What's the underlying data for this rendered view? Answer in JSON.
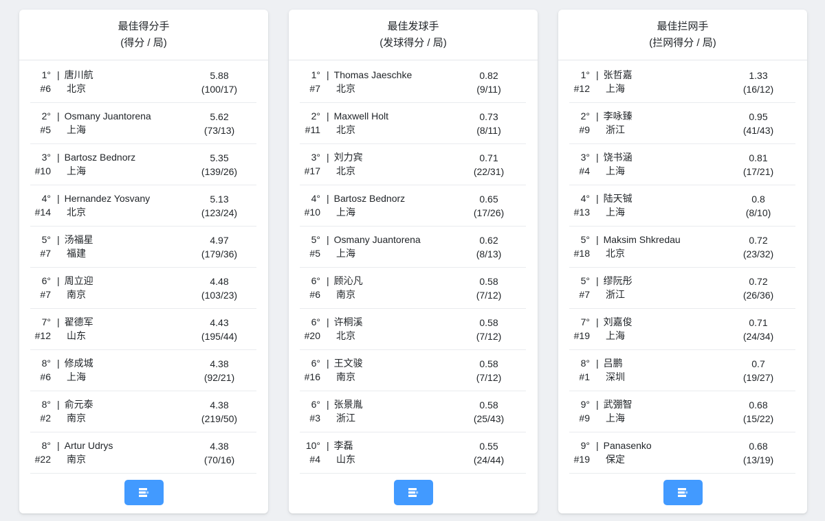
{
  "colors": {
    "accent_blue": "#429aff",
    "text": "#212529",
    "divider": "#e9ebee",
    "page_background": "#eef0f3",
    "card_background": "#ffffff"
  },
  "ui": {
    "pipe": "|",
    "footer_button_icon": "list-stats-icon"
  },
  "cards": [
    {
      "title": "最佳得分手",
      "subtitle": "(得分 / 局)",
      "rows": [
        {
          "rank": "1°",
          "number": "#6",
          "name": "唐川航",
          "team": "北京",
          "value": "5.88",
          "fraction": "(100/17)"
        },
        {
          "rank": "2°",
          "number": "#5",
          "name": "Osmany Juantorena",
          "team": "上海",
          "value": "5.62",
          "fraction": "(73/13)"
        },
        {
          "rank": "3°",
          "number": "#10",
          "name": "Bartosz Bednorz",
          "team": "上海",
          "value": "5.35",
          "fraction": "(139/26)"
        },
        {
          "rank": "4°",
          "number": "#14",
          "name": "Hernandez Yosvany",
          "team": "北京",
          "value": "5.13",
          "fraction": "(123/24)"
        },
        {
          "rank": "5°",
          "number": "#7",
          "name": "汤福星",
          "team": "福建",
          "value": "4.97",
          "fraction": "(179/36)"
        },
        {
          "rank": "6°",
          "number": "#7",
          "name": "周立迎",
          "team": "南京",
          "value": "4.48",
          "fraction": "(103/23)"
        },
        {
          "rank": "7°",
          "number": "#12",
          "name": "翟德军",
          "team": "山东",
          "value": "4.43",
          "fraction": "(195/44)"
        },
        {
          "rank": "8°",
          "number": "#6",
          "name": "修成城",
          "team": "上海",
          "value": "4.38",
          "fraction": "(92/21)"
        },
        {
          "rank": "8°",
          "number": "#2",
          "name": "俞元泰",
          "team": "南京",
          "value": "4.38",
          "fraction": "(219/50)"
        },
        {
          "rank": "8°",
          "number": "#22",
          "name": "Artur Udrys",
          "team": "南京",
          "value": "4.38",
          "fraction": "(70/16)"
        }
      ]
    },
    {
      "title": "最佳发球手",
      "subtitle": "(发球得分 / 局)",
      "rows": [
        {
          "rank": "1°",
          "number": "#7",
          "name": "Thomas Jaeschke",
          "team": "北京",
          "value": "0.82",
          "fraction": "(9/11)"
        },
        {
          "rank": "2°",
          "number": "#11",
          "name": "Maxwell Holt",
          "team": "北京",
          "value": "0.73",
          "fraction": "(8/11)"
        },
        {
          "rank": "3°",
          "number": "#17",
          "name": "刘力宾",
          "team": "北京",
          "value": "0.71",
          "fraction": "(22/31)"
        },
        {
          "rank": "4°",
          "number": "#10",
          "name": "Bartosz Bednorz",
          "team": "上海",
          "value": "0.65",
          "fraction": "(17/26)"
        },
        {
          "rank": "5°",
          "number": "#5",
          "name": "Osmany Juantorena",
          "team": "上海",
          "value": "0.62",
          "fraction": "(8/13)"
        },
        {
          "rank": "6°",
          "number": "#6",
          "name": "顾沁凡",
          "team": "南京",
          "value": "0.58",
          "fraction": "(7/12)"
        },
        {
          "rank": "6°",
          "number": "#20",
          "name": "许桐溪",
          "team": "北京",
          "value": "0.58",
          "fraction": "(7/12)"
        },
        {
          "rank": "6°",
          "number": "#16",
          "name": "王文骏",
          "team": "南京",
          "value": "0.58",
          "fraction": "(7/12)"
        },
        {
          "rank": "6°",
          "number": "#3",
          "name": "张景胤",
          "team": "浙江",
          "value": "0.58",
          "fraction": "(25/43)"
        },
        {
          "rank": "10°",
          "number": "#4",
          "name": "李磊",
          "team": "山东",
          "value": "0.55",
          "fraction": "(24/44)"
        }
      ]
    },
    {
      "title": "最佳拦网手",
      "subtitle": "(拦网得分 / 局)",
      "rows": [
        {
          "rank": "1°",
          "number": "#12",
          "name": "张哲嘉",
          "team": "上海",
          "value": "1.33",
          "fraction": "(16/12)"
        },
        {
          "rank": "2°",
          "number": "#9",
          "name": "李咏臻",
          "team": "浙江",
          "value": "0.95",
          "fraction": "(41/43)"
        },
        {
          "rank": "3°",
          "number": "#4",
          "name": "饶书涵",
          "team": "上海",
          "value": "0.81",
          "fraction": "(17/21)"
        },
        {
          "rank": "4°",
          "number": "#13",
          "name": "陆天铖",
          "team": "上海",
          "value": "0.8",
          "fraction": "(8/10)"
        },
        {
          "rank": "5°",
          "number": "#18",
          "name": "Maksim Shkredau",
          "team": "北京",
          "value": "0.72",
          "fraction": "(23/32)"
        },
        {
          "rank": "5°",
          "number": "#7",
          "name": "缪阮彤",
          "team": "浙江",
          "value": "0.72",
          "fraction": "(26/36)"
        },
        {
          "rank": "7°",
          "number": "#19",
          "name": "刘嘉俊",
          "team": "上海",
          "value": "0.71",
          "fraction": "(24/34)"
        },
        {
          "rank": "8°",
          "number": "#1",
          "name": "吕鹏",
          "team": "深圳",
          "value": "0.7",
          "fraction": "(19/27)"
        },
        {
          "rank": "9°",
          "number": "#9",
          "name": "武弸智",
          "team": "上海",
          "value": "0.68",
          "fraction": "(15/22)"
        },
        {
          "rank": "9°",
          "number": "#19",
          "name": "Panasenko",
          "team": "保定",
          "value": "0.68",
          "fraction": "(13/19)"
        }
      ]
    }
  ]
}
